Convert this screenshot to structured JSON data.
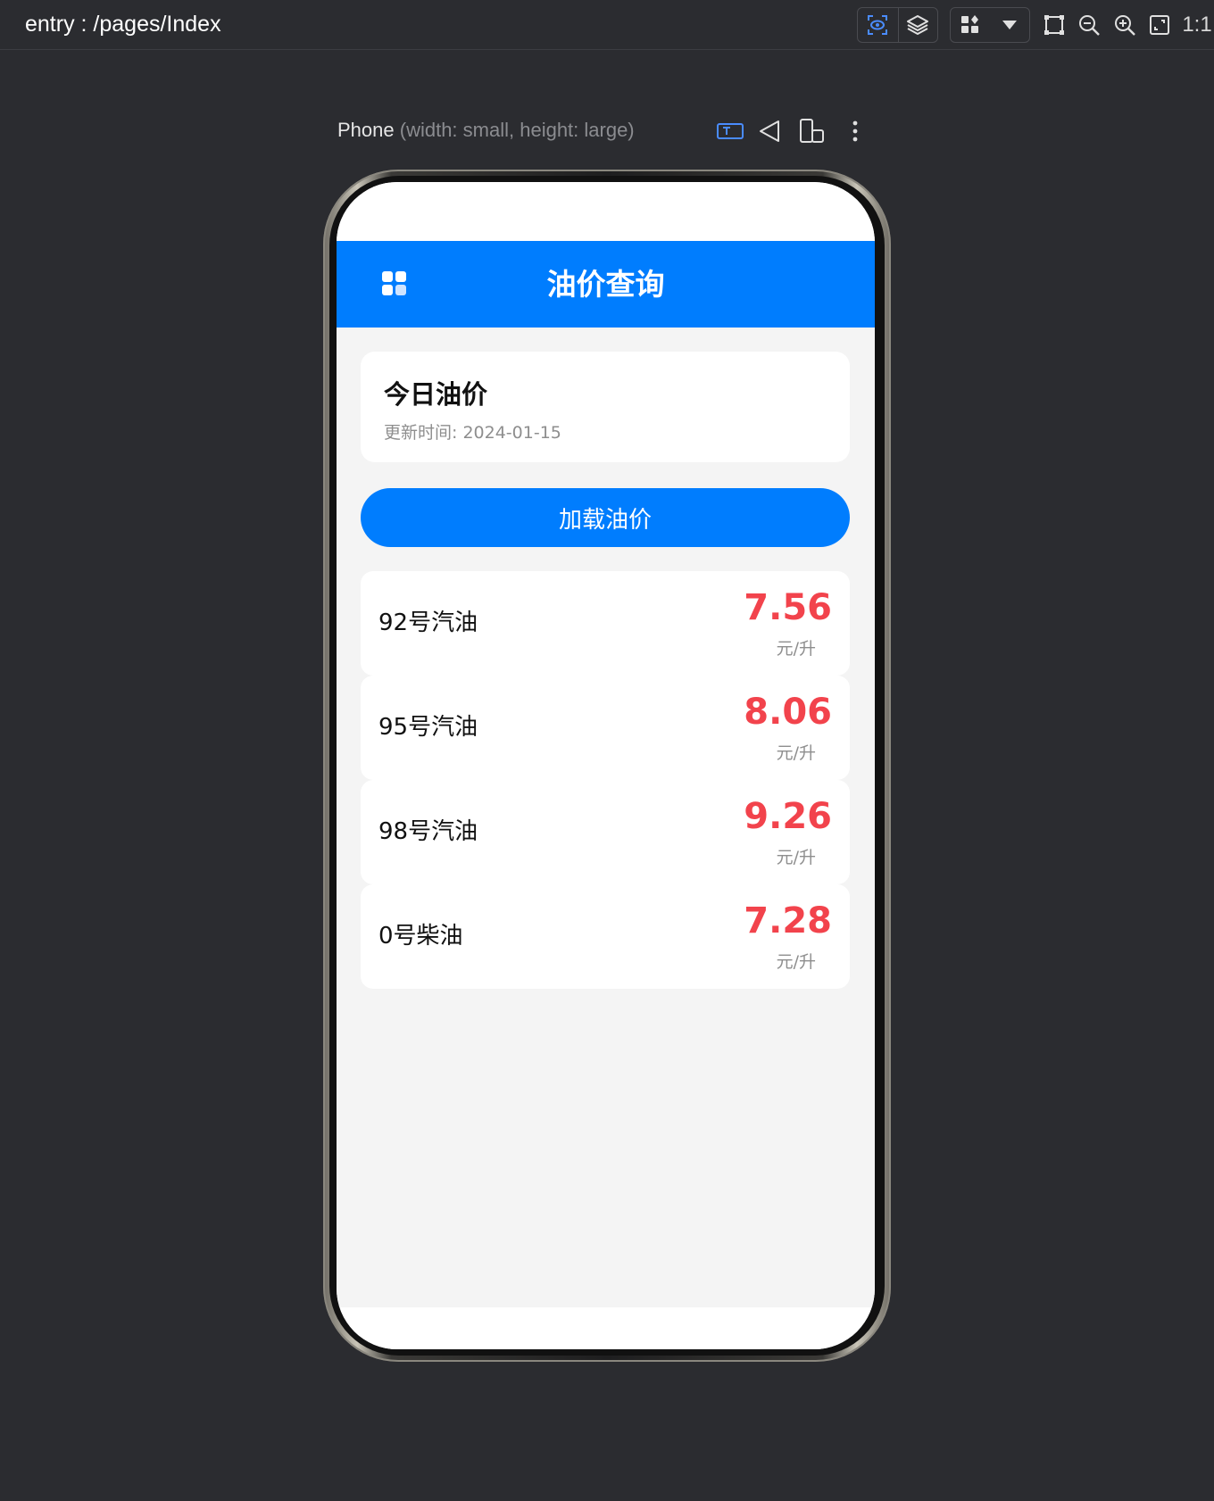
{
  "ide": {
    "path": "entry : /pages/Index",
    "ratio_label": "1:1"
  },
  "device": {
    "name": "Phone",
    "size_desc": "(width: small, height: large)"
  },
  "app": {
    "title": "油价查询",
    "info_card": {
      "title": "今日油价",
      "update_label": "更新时间: ",
      "update_date": "2024-01-15"
    },
    "load_button": "加载油价",
    "prices": [
      {
        "name": "92号汽油",
        "price": "7.56",
        "unit": "元/升"
      },
      {
        "name": "95号汽油",
        "price": "8.06",
        "unit": "元/升"
      },
      {
        "name": "98号汽油",
        "price": "9.26",
        "unit": "元/升"
      },
      {
        "name": "0号柴油",
        "price": "7.28",
        "unit": "元/升"
      }
    ]
  },
  "colors": {
    "accent": "#007dfe",
    "price": "#f2434c",
    "background": "#f4f4f4"
  },
  "icons": {
    "toolbar": [
      "inspect-icon",
      "layers-icon",
      "components-icon",
      "dropdown-icon",
      "frame-icon",
      "zoom-out-icon",
      "zoom-in-icon",
      "fit-icon"
    ],
    "device_tools": [
      "text-mode-icon",
      "rotate-icon",
      "device-switch-icon",
      "more-icon"
    ],
    "app": [
      "menu-grid-icon"
    ]
  }
}
